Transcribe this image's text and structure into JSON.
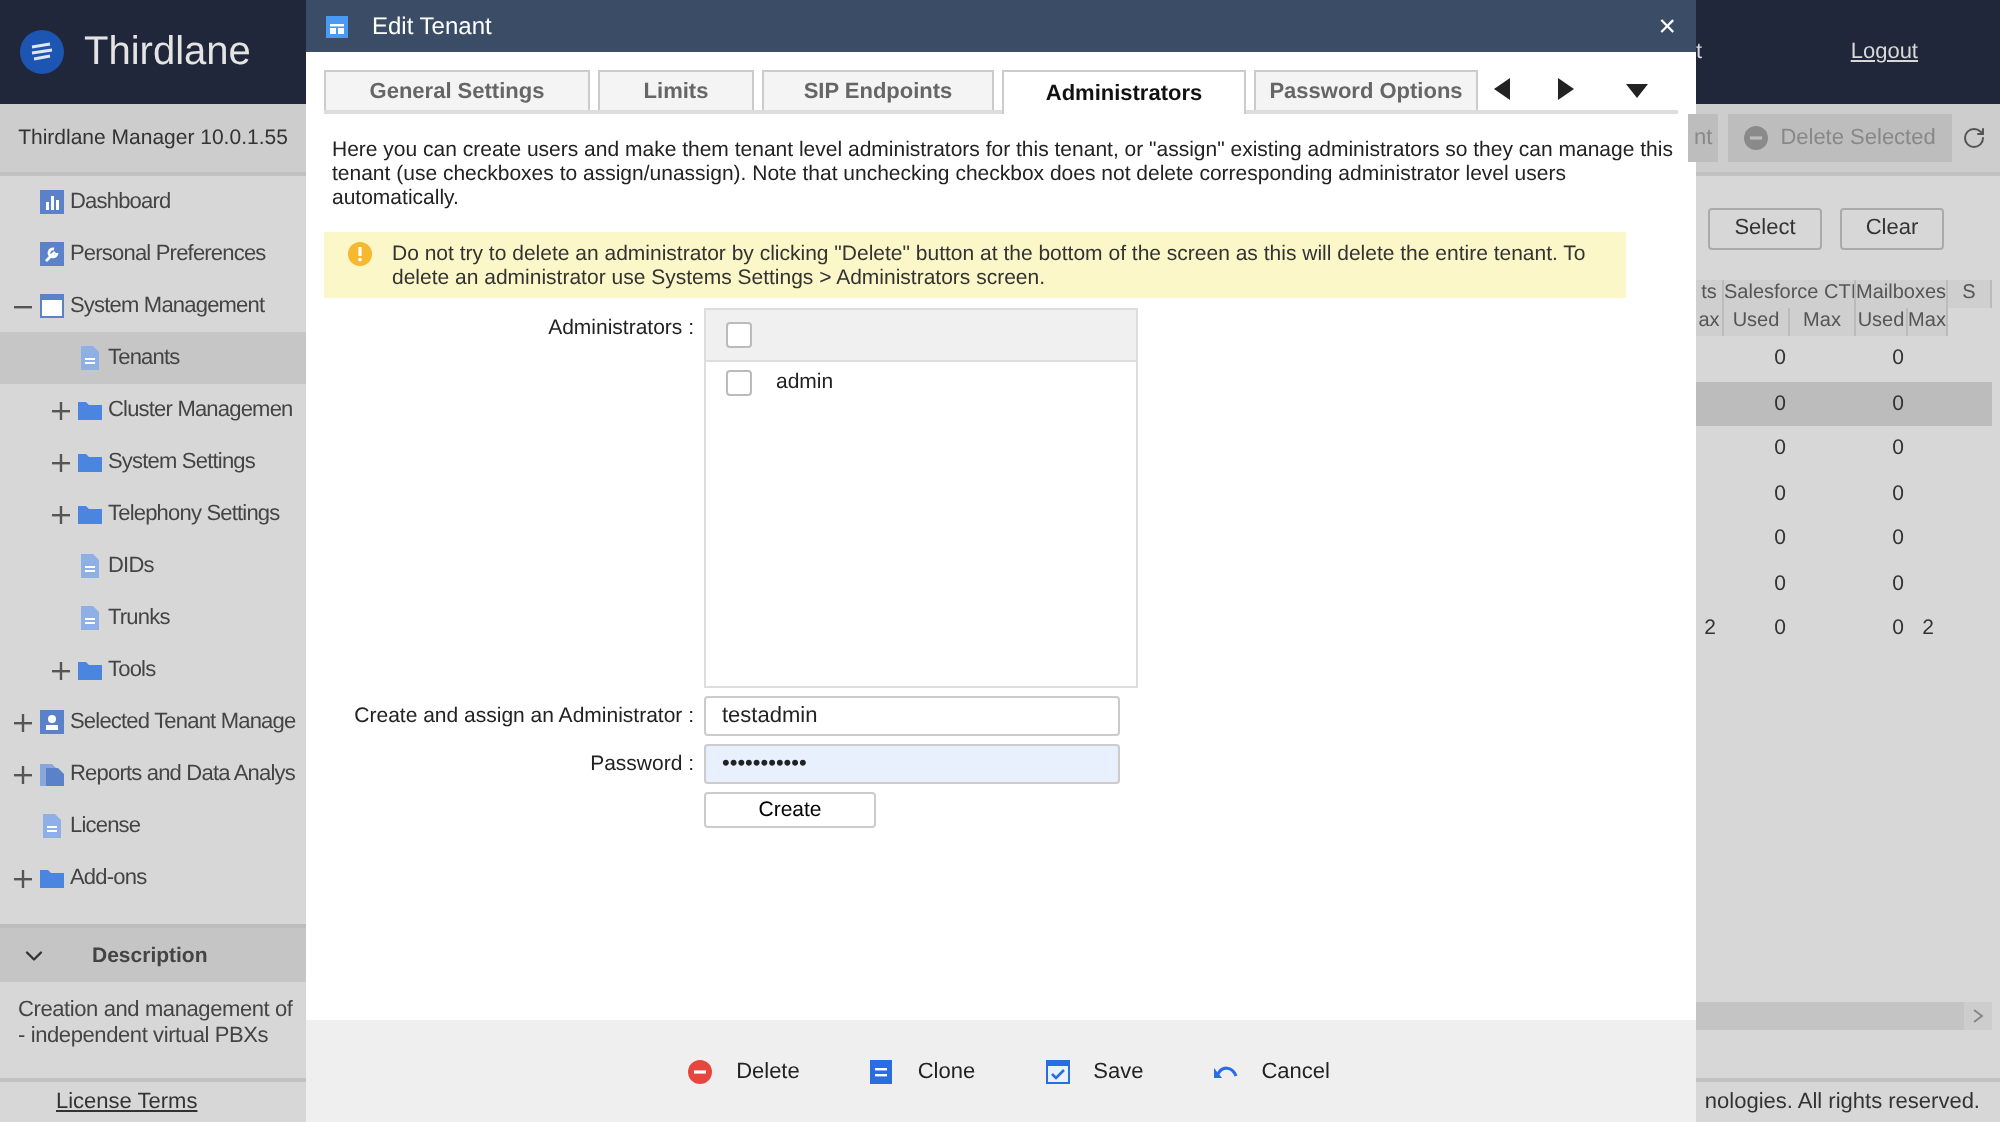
{
  "app": {
    "logo": "Thirdlane",
    "version": "Thirdlane Manager 10.0.1.55",
    "header_link_cut": "t",
    "logout": "Logout"
  },
  "sidebar": {
    "items": [
      {
        "label": "Dashboard",
        "kind": "dashboard",
        "selected": false
      },
      {
        "label": "Personal Preferences",
        "kind": "preferences",
        "selected": false
      },
      {
        "label": "System Management",
        "kind": "system",
        "selected": false,
        "expanded": true,
        "children": [
          {
            "label": "Tenants",
            "kind": "page",
            "selected": true
          },
          {
            "label": "Cluster Managemen",
            "kind": "folder",
            "selected": false,
            "expanded": false
          },
          {
            "label": "System Settings",
            "kind": "folder",
            "selected": false,
            "expanded": false
          },
          {
            "label": "Telephony Settings",
            "kind": "folder",
            "selected": false,
            "expanded": false
          },
          {
            "label": "DIDs",
            "kind": "page",
            "selected": false
          },
          {
            "label": "Trunks",
            "kind": "page",
            "selected": false
          },
          {
            "label": "Tools",
            "kind": "folder",
            "selected": false,
            "expanded": false
          }
        ]
      },
      {
        "label": "Selected Tenant Manage",
        "kind": "tenant",
        "selected": false,
        "expanded": false
      },
      {
        "label": "Reports and Data Analys",
        "kind": "reports",
        "selected": false,
        "expanded": false
      },
      {
        "label": "License",
        "kind": "page",
        "selected": false
      },
      {
        "label": "Add-ons",
        "kind": "folder",
        "selected": false,
        "expanded": false
      }
    ]
  },
  "description": {
    "title": "Description",
    "expanded": true,
    "lines": [
      "Creation and management of",
      "- independent virtual PBXs"
    ]
  },
  "footer": {
    "link": "License Terms",
    "copyright": "nologies. All rights reserved."
  },
  "toolbar": {
    "buttons": [
      {
        "label": "nt",
        "kind": "plain"
      },
      {
        "label": "Delete Selected",
        "kind": "delete"
      }
    ]
  },
  "selection_buttons": [
    "Select",
    "Clear"
  ],
  "table": {
    "groups": [
      "ts",
      "Salesforce CTI",
      "Mailboxes",
      "S"
    ],
    "subcolumns": [
      "ax",
      "Used",
      "Max",
      "Used",
      "Max"
    ],
    "rows": [
      {
        "selected": false,
        "salesforce_used": "0",
        "mailboxes_used": "0"
      },
      {
        "selected": true,
        "salesforce_used": "0",
        "mailboxes_used": "0"
      },
      {
        "selected": false,
        "salesforce_used": "0",
        "mailboxes_used": "0"
      },
      {
        "selected": false,
        "salesforce_used": "0",
        "mailboxes_used": "0"
      },
      {
        "selected": false,
        "salesforce_used": "0",
        "mailboxes_used": "0"
      },
      {
        "selected": false,
        "salesforce_used": "0",
        "mailboxes_used": "0"
      },
      {
        "selected": false,
        "column_1": "2",
        "salesforce_used": "0",
        "mailboxes_used": "0",
        "mailboxes_max": "2"
      }
    ]
  },
  "dialog": {
    "title": "Edit Tenant",
    "close": "×",
    "tabs": [
      {
        "label": "General Settings",
        "selected": false
      },
      {
        "label": "Limits",
        "selected": false
      },
      {
        "label": "SIP Endpoints",
        "selected": false
      },
      {
        "label": "Administrators",
        "selected": true
      },
      {
        "label": "Password Options",
        "selected": false
      }
    ],
    "intro": "Here you can create users and make them tenant level administrators for this tenant, or \"assign\" existing administrators so they can manage this tenant (use checkboxes to assign/unassign). Note that unchecking checkbox does not delete corresponding administrator level users automatically.",
    "warning": "Do not try to delete an administrator by clicking \"Delete\" button at the bottom of the screen as this will delete the entire tenant. To delete an administrator use Systems Settings > Administrators screen.",
    "administrators_label": "Administrators :",
    "select_all_checked": false,
    "administrators": [
      {
        "name": "admin",
        "checked": false
      }
    ],
    "create_label": "Create and assign an Administrator :",
    "create_value": "testadmin",
    "password_label": "Password :",
    "password_value": "•••••••••••",
    "password_focused": true,
    "create_button": "Create",
    "actions": [
      {
        "label": "Delete",
        "kind": "delete"
      },
      {
        "label": "Clone",
        "kind": "clone"
      },
      {
        "label": "Save",
        "kind": "save"
      },
      {
        "label": "Cancel",
        "kind": "cancel"
      }
    ]
  }
}
